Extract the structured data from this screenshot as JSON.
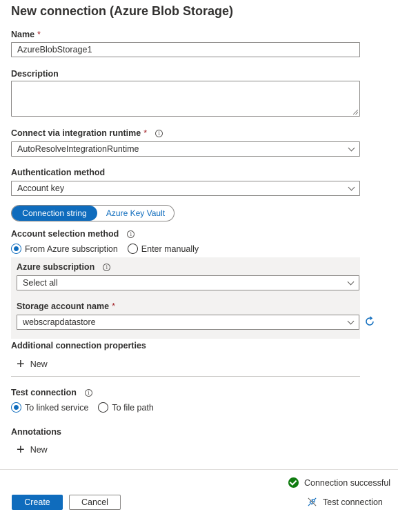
{
  "title": "New connection (Azure Blob Storage)",
  "name": {
    "label": "Name",
    "required": "*",
    "value": "AzureBlobStorage1"
  },
  "description": {
    "label": "Description",
    "value": ""
  },
  "runtime": {
    "label": "Connect via integration runtime",
    "required": "*",
    "info": "i",
    "value": "AutoResolveIntegrationRuntime"
  },
  "auth": {
    "label": "Authentication method",
    "value": "Account key"
  },
  "secret_toggle": {
    "options": [
      "Connection string",
      "Azure Key Vault"
    ],
    "selected": "Connection string"
  },
  "account_selection": {
    "label": "Account selection method",
    "info": "i",
    "options": [
      "From Azure subscription",
      "Enter manually"
    ],
    "selected": "From Azure subscription"
  },
  "subscription": {
    "label": "Azure subscription",
    "info": "i",
    "value": "Select all"
  },
  "storage_account": {
    "label": "Storage account name",
    "required": "*",
    "value": "webscrapdatastore"
  },
  "additional_props": {
    "label": "Additional connection properties",
    "new_label": "New"
  },
  "test_connection": {
    "label": "Test connection",
    "info": "i",
    "options": [
      "To linked service",
      "To file path"
    ],
    "selected": "To linked service"
  },
  "annotations": {
    "label": "Annotations",
    "new_label": "New"
  },
  "status": {
    "text": "Connection successful",
    "color": "#107c10"
  },
  "footer": {
    "create_label": "Create",
    "cancel_label": "Cancel",
    "test_label": "Test connection"
  },
  "colors": {
    "accent": "#0f6cbd",
    "success": "#107c10",
    "required": "#a4262c"
  },
  "icons": [
    "info-icon",
    "chevron-down-icon",
    "refresh-icon",
    "plus-icon",
    "check-circle-icon",
    "plug-icon"
  ]
}
